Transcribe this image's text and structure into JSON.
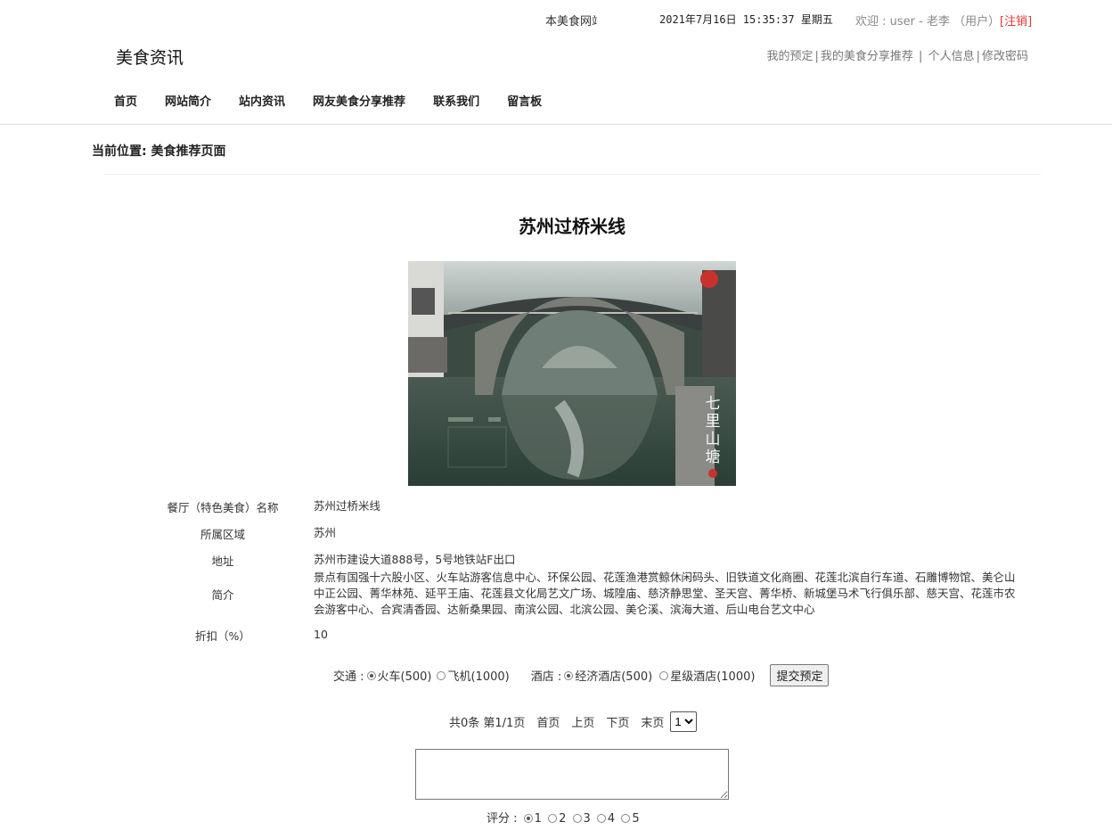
{
  "topbar": {
    "marquee": "本美食网站",
    "datetime": "2021年7月16日 15:35:37 星期五",
    "welcome": "欢迎 : user - 老李 （用户）",
    "logout": "[注销]"
  },
  "header": {
    "site_title": "美食资讯",
    "user_links": [
      "我的预定",
      "我的美食分享推荐",
      "个人信息",
      "修改密码"
    ]
  },
  "nav": [
    "首页",
    "网站简介",
    "站内资讯",
    "网友美食分享推荐",
    "联系我们",
    "留言板"
  ],
  "breadcrumb": "当前位置: 美食推荐页面",
  "food": {
    "title": "苏州过桥米线",
    "photo_caption": "七里山塘",
    "fields": [
      {
        "label": "餐厅（特色美食）名称",
        "value": "苏州过桥米线"
      },
      {
        "label": "所属区域",
        "value": "苏州"
      },
      {
        "label": "地址",
        "value": "苏州市建设大道888号，5号地铁站F出口"
      },
      {
        "label": "简介",
        "value": "景点有国强十六股小区、火车站游客信息中心、环保公园、花莲渔港赏鲸休闲码头、旧铁道文化商圈、花莲北滨自行车道、石雕博物馆、美仑山中正公园、菁华林苑、延平王庙、花莲县文化局艺文广场、城隍庙、慈济静思堂、圣天宫、菁华桥、新城堡马术飞行俱乐部、慈天宫、花莲市农会游客中心、合宾清香园、达新桑果园、南滨公园、北滨公园、美仑溪、滨海大道、后山电台艺文中心"
      },
      {
        "label": "折扣（%）",
        "value": "10"
      }
    ]
  },
  "booking": {
    "transport_label": "交通 :",
    "transport_options": [
      "火车(500)",
      "飞机(1000)"
    ],
    "hotel_label": "酒店 :",
    "hotel_options": [
      "经济酒店(500)",
      "星级酒店(1000)"
    ],
    "submit": "提交预定"
  },
  "pager": {
    "summary": "共0条  第1/1页",
    "first": "首页",
    "prev": "上页",
    "next": "下页",
    "last": "末页",
    "page_select": "1"
  },
  "rating": {
    "label": "评分 :",
    "options": [
      "1",
      "2",
      "3",
      "4",
      "5"
    ]
  }
}
